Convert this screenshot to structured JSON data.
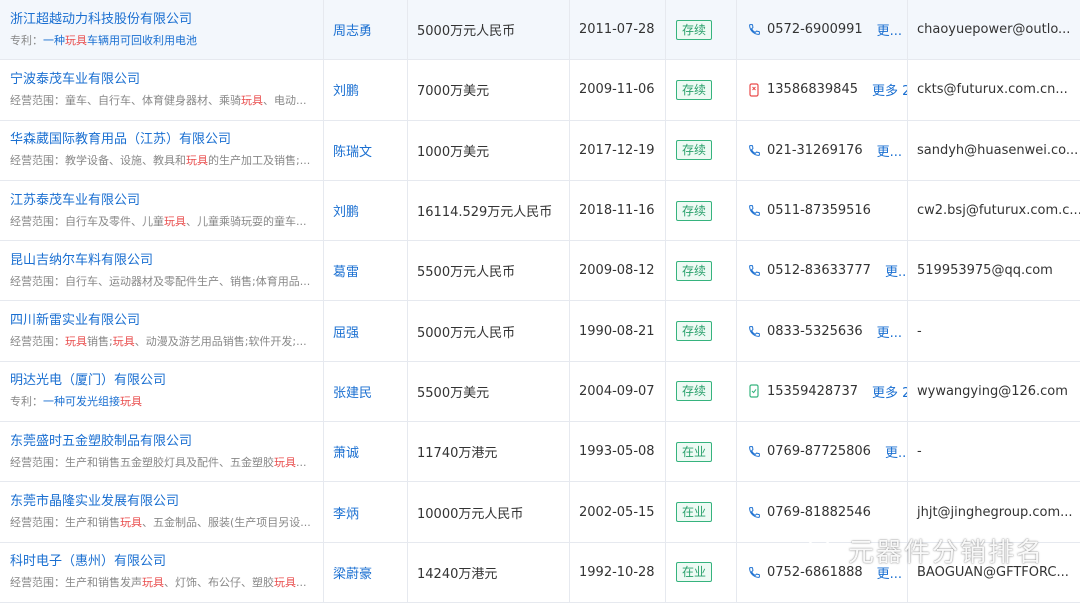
{
  "rows": [
    {
      "name": "浙江超越动力科技股份有限公司",
      "sub_label": "专利：",
      "sub_pre": "一种",
      "sub_hl": "玩具",
      "sub_post": "车辆用可回收利用电池",
      "sub_type": "patent",
      "person": "周志勇",
      "capital": "5000万元人民币",
      "date": "2011-07-28",
      "status": "存续",
      "phone_icon": "phone-icon",
      "phone": "0572-6900991",
      "more": "更...",
      "email": "chaoyuepower@outlo..."
    },
    {
      "name": "宁波泰茂车业有限公司",
      "sub_label": "经营范围：",
      "sub_pre": "童车、自行车、体育健身器材、乘骑",
      "sub_hl": "玩具",
      "sub_post": "、电动...",
      "sub_type": "scope",
      "person": "刘鹏",
      "capital": "7000万美元",
      "date": "2009-11-06",
      "status": "存续",
      "phone_icon": "mobile-icon",
      "phone": "13586839845",
      "more": "更多 2",
      "email": "ckts@futurux.com.cn..."
    },
    {
      "name": "华森葳国际教育用品（江苏）有限公司",
      "sub_label": "经营范围：",
      "sub_pre": "教学设备、设施、教具和",
      "sub_hl": "玩具",
      "sub_post": "的生产加工及销售;...",
      "sub_type": "scope",
      "person": "陈瑞文",
      "capital": "1000万美元",
      "date": "2017-12-19",
      "status": "存续",
      "phone_icon": "phone-icon",
      "phone": "021-31269176",
      "more": "更...",
      "email": "sandyh@huasenwei.co..."
    },
    {
      "name": "江苏泰茂车业有限公司",
      "sub_label": "经营范围：",
      "sub_pre": "自行车及零件、儿童",
      "sub_hl": "玩具",
      "sub_post": "、儿童乘骑玩耍的童车...",
      "sub_type": "scope",
      "person": "刘鹏",
      "capital": "16114.529万元人民币",
      "date": "2018-11-16",
      "status": "存续",
      "phone_icon": "phone-icon",
      "phone": "0511-87359516",
      "more": "",
      "email": "cw2.bsj@futurux.com.c..."
    },
    {
      "name": "昆山吉纳尔车料有限公司",
      "sub_label": "经营范围：",
      "sub_pre": "自行车、运动器材及零配件生产、销售;体育用品...",
      "sub_hl": "",
      "sub_post": "",
      "sub_type": "scope",
      "person": "葛雷",
      "capital": "5500万元人民币",
      "date": "2009-08-12",
      "status": "存续",
      "phone_icon": "phone-icon",
      "phone": "0512-83633777",
      "more": "更...",
      "email": "519953975@qq.com"
    },
    {
      "name": "四川新雷实业有限公司",
      "sub_label": "经营范围：",
      "sub_pre": "",
      "sub_hl": "玩具",
      "sub_post": "销售;",
      "sub_hl2": "玩具",
      "sub_post2": "、动漫及游艺用品销售;软件开发;...",
      "sub_type": "scope",
      "person": "屈强",
      "capital": "5000万元人民币",
      "date": "1990-08-21",
      "status": "存续",
      "phone_icon": "phone-icon",
      "phone": "0833-5325636",
      "more": "更...",
      "email": "-"
    },
    {
      "name": "明达光电（厦门）有限公司",
      "sub_label": "专利：",
      "sub_pre": "一种可发光组接",
      "sub_hl": "玩具",
      "sub_post": "",
      "sub_type": "patent",
      "person": "张建民",
      "capital": "5500万美元",
      "date": "2004-09-07",
      "status": "存续",
      "phone_icon": "mobile-green-icon",
      "phone": "15359428737",
      "more": "更多 2",
      "email": "wywangying@126.com"
    },
    {
      "name": "东莞盛时五金塑胶制品有限公司",
      "sub_label": "经营范围：",
      "sub_pre": "生产和销售五金塑胶灯具及配件、五金塑胶",
      "sub_hl": "玩具",
      "sub_post": "...",
      "sub_type": "scope",
      "person": "萧诚",
      "capital": "11740万港元",
      "date": "1993-05-08",
      "status": "在业",
      "phone_icon": "phone-icon",
      "phone": "0769-87725806",
      "more": "更...",
      "email": "-"
    },
    {
      "name": "东莞市晶隆实业发展有限公司",
      "sub_label": "经营范围：",
      "sub_pre": "生产和销售",
      "sub_hl": "玩具",
      "sub_post": "、五金制品、服装(生产项目另设...",
      "sub_type": "scope",
      "person": "李炳",
      "capital": "10000万元人民币",
      "date": "2002-05-15",
      "status": "在业",
      "phone_icon": "phone-icon",
      "phone": "0769-81882546",
      "more": "",
      "email": "jhjt@jinghegroup.com..."
    },
    {
      "name": "科时电子（惠州）有限公司",
      "sub_label": "经营范围：",
      "sub_pre": "生产和销售发声",
      "sub_hl": "玩具",
      "sub_post": "、灯饰、布公仔、塑胶",
      "sub_hl2": "玩具",
      "sub_post2": "...",
      "sub_type": "scope",
      "person": "梁蔚豪",
      "capital": "14240万港元",
      "date": "1992-10-28",
      "status": "在业",
      "phone_icon": "phone-icon",
      "phone": "0752-6861888",
      "more": "更...",
      "email": "BAOGUAN@GFTFORC..."
    }
  ],
  "watermark": {
    "text": "元器件分销排名"
  },
  "colors": {
    "link": "#1a6fd1",
    "highlight": "#e94b4b",
    "badge_green": "#2aa06b"
  }
}
